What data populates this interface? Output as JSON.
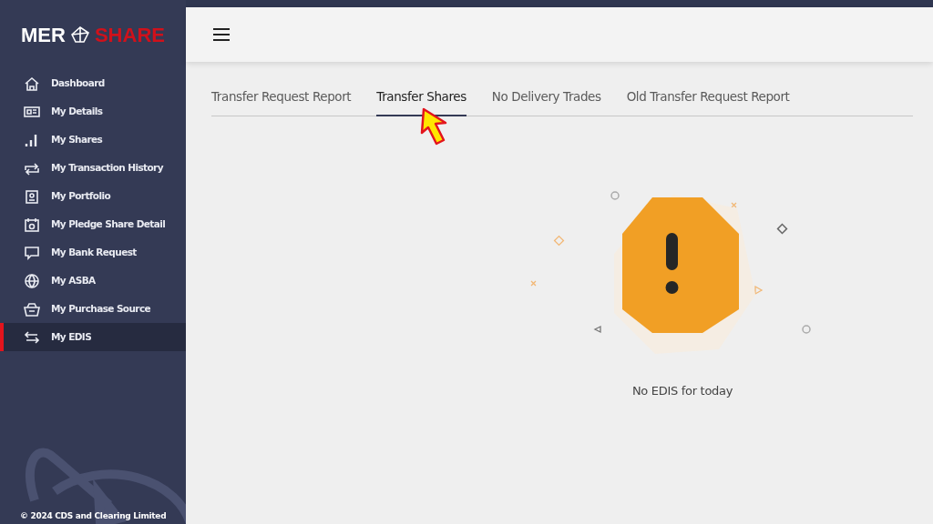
{
  "logo": {
    "left": "MER",
    "right": "SHARE"
  },
  "sidebar": {
    "items": [
      {
        "label": "Dashboard",
        "selected": false
      },
      {
        "label": "My Details",
        "selected": false
      },
      {
        "label": "My Shares",
        "selected": false
      },
      {
        "label": "My Transaction History",
        "selected": false
      },
      {
        "label": "My Portfolio",
        "selected": false
      },
      {
        "label": "My Pledge Share Detail",
        "selected": false
      },
      {
        "label": "My Bank Request",
        "selected": false
      },
      {
        "label": "My ASBA",
        "selected": false
      },
      {
        "label": "My Purchase Source",
        "selected": false
      },
      {
        "label": "My EDIS",
        "selected": true
      }
    ],
    "footer": "© 2024 CDS and Clearing Limited"
  },
  "tabs": [
    {
      "label": "Transfer Request Report",
      "selected": false
    },
    {
      "label": "Transfer Shares",
      "selected": true
    },
    {
      "label": "No Delivery Trades",
      "selected": false
    },
    {
      "label": "Old Transfer Request Report",
      "selected": false
    }
  ],
  "empty_state": {
    "message": "No EDIS for today"
  }
}
